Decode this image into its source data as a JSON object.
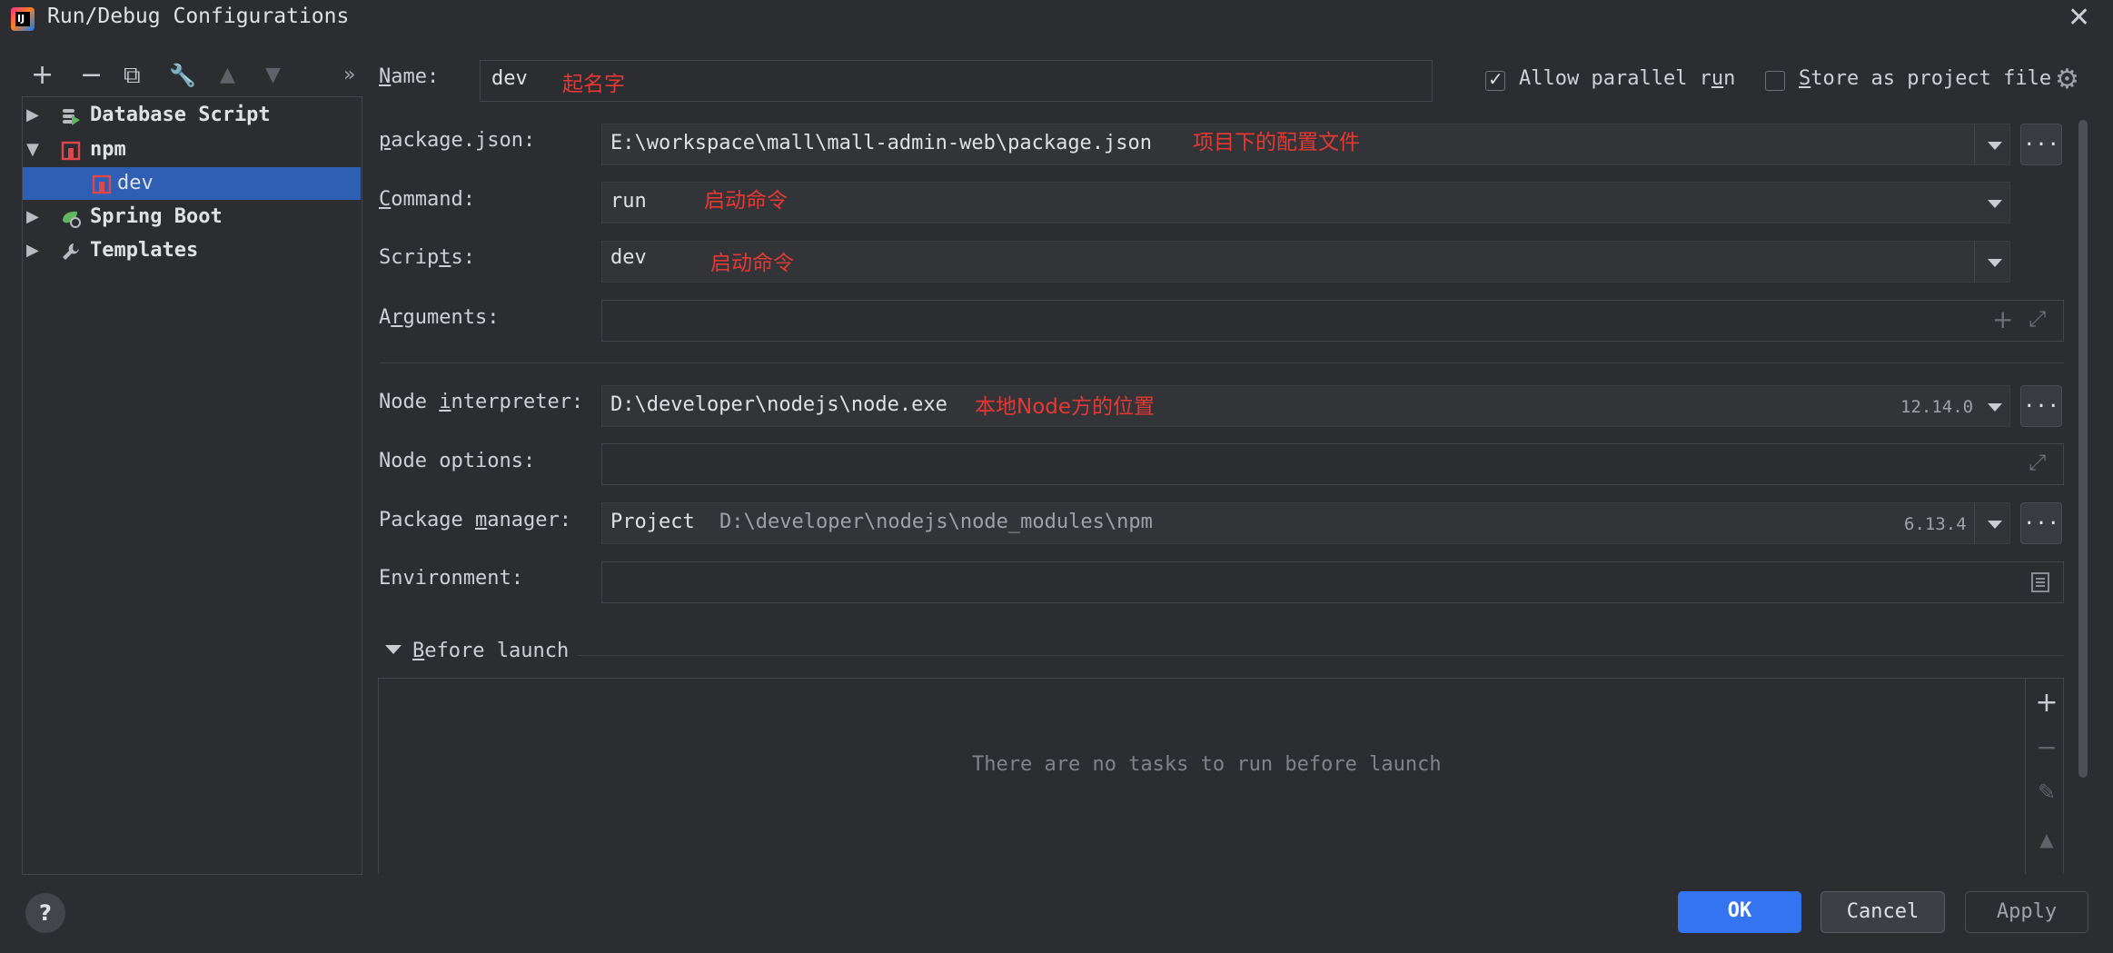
{
  "window": {
    "title": "Run/Debug Configurations",
    "app_icon": "IJ"
  },
  "toolbar": {
    "add": "+",
    "remove": "−",
    "copy": "⧉",
    "edit": "🔧",
    "move_up": "▲",
    "move_down": "▼",
    "more": "»"
  },
  "tree": {
    "items": [
      {
        "label": "Database Script",
        "icon": "database-script-icon",
        "expanded": false
      },
      {
        "label": "npm",
        "icon": "npm-icon",
        "expanded": true
      },
      {
        "label": "dev",
        "icon": "npm-icon",
        "selected": true
      },
      {
        "label": "Spring Boot",
        "icon": "spring-boot-icon",
        "expanded": false
      },
      {
        "label": "Templates",
        "icon": "wrench-icon",
        "expanded": false
      }
    ]
  },
  "form": {
    "name": {
      "label_pre": "",
      "label_u": "N",
      "label_post": "ame:",
      "value": "dev",
      "annotation": "起名字"
    },
    "allow_parallel": {
      "label_pre": "Allow parallel r",
      "label_u": "u",
      "label_post": "n",
      "checked": true
    },
    "store_project": {
      "label_pre": "",
      "label_u": "S",
      "label_post": "tore as project file",
      "checked": false
    },
    "package_json": {
      "label_pre": "",
      "label_u": "p",
      "label_post": "ackage.json:",
      "value": "E:\\workspace\\mall\\mall-admin-web\\package.json",
      "annotation": "项目下的配置文件"
    },
    "command": {
      "label_pre": "",
      "label_u": "C",
      "label_post": "ommand:",
      "value": "run",
      "annotation": "启动命令"
    },
    "scripts": {
      "label_pre": "Scrip",
      "label_u": "t",
      "label_post": "s:",
      "value": "dev",
      "annotation": "启动命令"
    },
    "arguments": {
      "label_pre": "A",
      "label_u": "r",
      "label_post": "guments:",
      "value": ""
    },
    "node_interpreter": {
      "label_pre": "Node ",
      "label_u": "i",
      "label_post": "nterpreter:",
      "value": "D:\\developer\\nodejs\\node.exe",
      "annotation": "本地Node方的位置",
      "version": "12.14.0"
    },
    "node_options": {
      "label": "Node options:",
      "value": ""
    },
    "package_manager": {
      "label_pre": "Package ",
      "label_u": "m",
      "label_post": "anager:",
      "project": "Project",
      "path": "D:\\developer\\nodejs\\node_modules\\npm",
      "version": "6.13.4"
    },
    "environment": {
      "label": "Environment:",
      "value": ""
    }
  },
  "before_launch": {
    "title_u": "B",
    "title_post": "efore launch",
    "empty_text": "There are no tasks to run before launch"
  },
  "buttons": {
    "help": "?",
    "browse": "...",
    "ok": "OK",
    "cancel": "Cancel",
    "apply": "Apply"
  }
}
